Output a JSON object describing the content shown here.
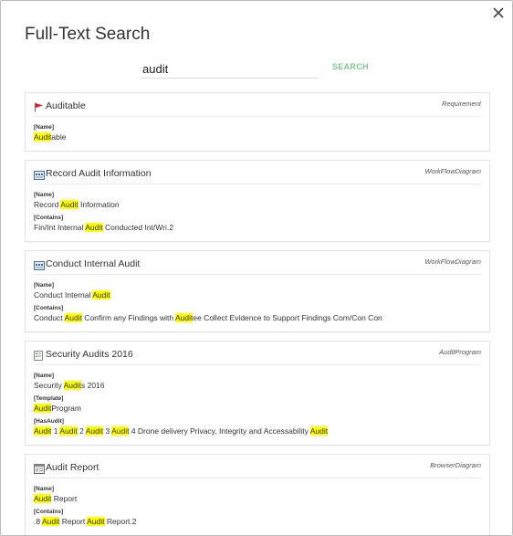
{
  "dialog": {
    "title": "Full-Text Search"
  },
  "search": {
    "value": "audit",
    "button_label": "SEARCH",
    "highlight_color": "#ffff00"
  },
  "results": [
    {
      "icon": "flag-icon",
      "title": "Auditable",
      "type": "Requirement",
      "fields": [
        {
          "label": "[Name]",
          "parts": [
            {
              "t": "Audit",
              "h": true
            },
            {
              "t": "able",
              "h": false
            }
          ]
        }
      ]
    },
    {
      "icon": "workflow-diagram-icon",
      "title": "Record Audit Information",
      "type": "WorkFlowDiagram",
      "fields": [
        {
          "label": "[Name]",
          "parts": [
            {
              "t": "Record ",
              "h": false
            },
            {
              "t": "Audit",
              "h": true
            },
            {
              "t": " Information",
              "h": false
            }
          ]
        },
        {
          "label": "[Contains]",
          "parts": [
            {
              "t": "Fin/Int Internal ",
              "h": false
            },
            {
              "t": "Audit",
              "h": true
            },
            {
              "t": " Conducted Int/Wri.2",
              "h": false
            }
          ]
        }
      ]
    },
    {
      "icon": "workflow-diagram-icon",
      "title": "Conduct Internal Audit",
      "type": "WorkFlowDiagram",
      "fields": [
        {
          "label": "[Name]",
          "parts": [
            {
              "t": "Conduct Internal ",
              "h": false
            },
            {
              "t": "Audit",
              "h": true
            }
          ]
        },
        {
          "label": "[Contains]",
          "parts": [
            {
              "t": "Conduct ",
              "h": false
            },
            {
              "t": "Audit",
              "h": true
            },
            {
              "t": " Confirm any Findings with ",
              "h": false
            },
            {
              "t": "Audit",
              "h": true
            },
            {
              "t": "ee Collect Evidence to Support Findings Com/Con Con",
              "h": false
            }
          ]
        }
      ]
    },
    {
      "icon": "audit-program-icon",
      "title": "Security Audits 2016",
      "type": "AuditProgram",
      "fields": [
        {
          "label": "[Name]",
          "parts": [
            {
              "t": "Security ",
              "h": false
            },
            {
              "t": "Audit",
              "h": true
            },
            {
              "t": "s 2016",
              "h": false
            }
          ]
        },
        {
          "label": "[Template]",
          "parts": [
            {
              "t": "Audit",
              "h": true
            },
            {
              "t": "Program",
              "h": false
            }
          ]
        },
        {
          "label": "[HasAudit]",
          "parts": [
            {
              "t": "Audit",
              "h": true
            },
            {
              "t": " 1 ",
              "h": false
            },
            {
              "t": "Audit",
              "h": true
            },
            {
              "t": " 2 ",
              "h": false
            },
            {
              "t": "Audit",
              "h": true
            },
            {
              "t": " 3 ",
              "h": false
            },
            {
              "t": "Audit",
              "h": true
            },
            {
              "t": " 4 Drone delivery Privacy, Integrity and Accessability ",
              "h": false
            },
            {
              "t": "Audit",
              "h": true
            }
          ]
        }
      ]
    },
    {
      "icon": "browser-diagram-icon",
      "title": "Audit Report",
      "type": "BrowserDiagram",
      "fields": [
        {
          "label": "[Name]",
          "parts": [
            {
              "t": "Audit",
              "h": true
            },
            {
              "t": " Report",
              "h": false
            }
          ]
        },
        {
          "label": "[Contains]",
          "parts": [
            {
              "t": ".8 ",
              "h": false
            },
            {
              "t": "Audit",
              "h": true
            },
            {
              "t": " Report ",
              "h": false
            },
            {
              "t": "Audit",
              "h": true
            },
            {
              "t": " Report.2",
              "h": false
            }
          ]
        }
      ]
    }
  ]
}
